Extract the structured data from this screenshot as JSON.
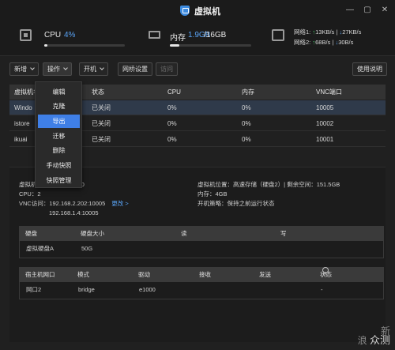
{
  "window": {
    "title": "虚拟机",
    "controls": [
      "—",
      "▢",
      "✕"
    ]
  },
  "stats": {
    "cpu": {
      "label": "CPU",
      "value": "4%",
      "fraction": 0.04
    },
    "memory": {
      "label": "内存",
      "used": "1.9GB",
      "total": "/16GB",
      "fraction": 0.12
    },
    "network": [
      {
        "label": "网络1:",
        "up": "↑",
        "up_value": "13KB/s",
        "sep": "|",
        "down": "↓",
        "down_value": "27KB/s"
      },
      {
        "label": "网络2:",
        "up": "↑",
        "up_value": "68B/s",
        "sep": "|",
        "down": "↓",
        "down_value": "30B/s"
      }
    ]
  },
  "toolbar": {
    "new_label": "新增",
    "ops_label": "操作",
    "power_label": "开机",
    "bridge_label": "网桥设置",
    "access_label": "访问",
    "help_label": "使用说明"
  },
  "vm_table": {
    "headers": [
      "虚拟机名",
      "状态",
      "CPU",
      "内存",
      "VNC端口"
    ],
    "rows": [
      {
        "name": "Windo",
        "status": "已关闭",
        "cpu": "0%",
        "mem": "0%",
        "vnc": "10005"
      },
      {
        "name": "istore",
        "status": "已关闭",
        "cpu": "0%",
        "mem": "0%",
        "vnc": "10002"
      },
      {
        "name": "ikuai",
        "status": "已关闭",
        "cpu": "0%",
        "mem": "0%",
        "vnc": "10001"
      }
    ]
  },
  "ops_menu": [
    "编辑",
    "克隆",
    "导出",
    "迁移",
    "删除",
    "手动快照",
    "快照管理"
  ],
  "detail": {
    "name_prefix": "虚拟机",
    "name_suffix": "10",
    "cpu": "CPU：2",
    "vnc_label": "VNC访问：",
    "vnc_addr1": "192.168.2.202:10005",
    "change_link": "更改 >",
    "vnc_addr2": "192.168.1.4:10005",
    "location": "虚拟机位置：高速存储（硬盘2）| 剩余空间：151.5GB",
    "memory": "内存：4GB",
    "boot_policy": "开机策略：保持之前运行状态"
  },
  "disk_table": {
    "headers": [
      "硬盘",
      "硬盘大小",
      "读",
      "写"
    ],
    "rows": [
      {
        "disk": "虚拟硬盘A",
        "size": "50G",
        "read": "",
        "write": ""
      }
    ]
  },
  "nic_table": {
    "headers": [
      "宿主机网口",
      "模式",
      "驱动",
      "接收",
      "发送",
      "状态"
    ],
    "help_glyph": "?",
    "rows": [
      {
        "port": "网口2",
        "mode": "bridge",
        "driver": "e1000",
        "rx": "",
        "tx": "",
        "status": "-"
      }
    ]
  },
  "watermark": {
    "line1": "新",
    "line2": "浪",
    "line3": "众测"
  }
}
